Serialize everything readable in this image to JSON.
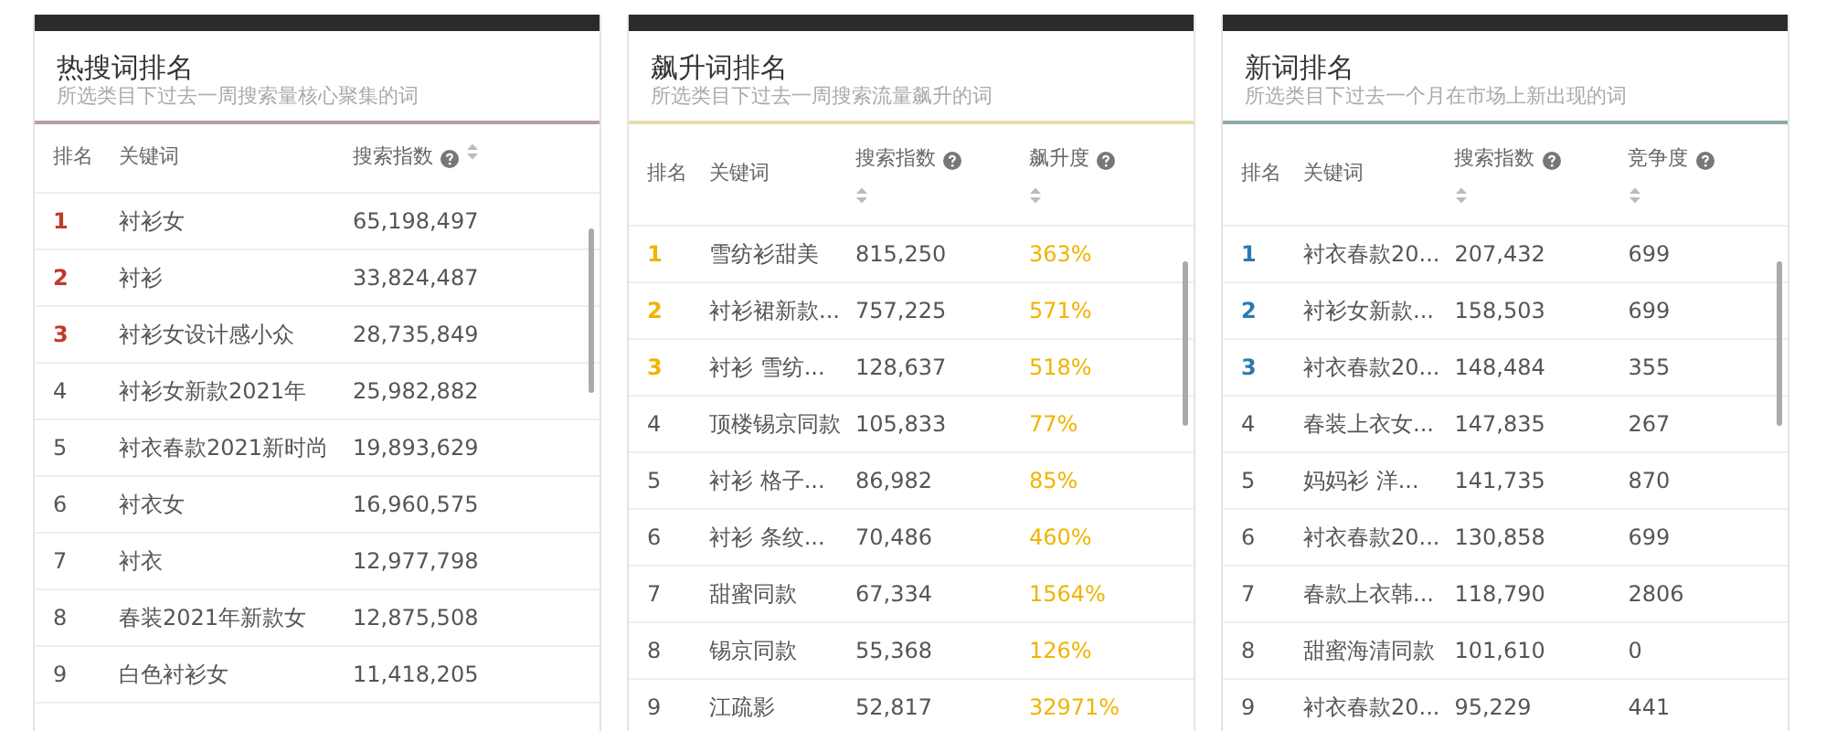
{
  "panels": [
    {
      "kind": "hot",
      "title": "热搜词排名",
      "subtitle": "所选类目下过去一周搜索量核心聚集的词",
      "columns": [
        {
          "label": "排名",
          "kind": "rank",
          "help": false,
          "sortable": false
        },
        {
          "label": "关键词",
          "kind": "text",
          "help": false,
          "sortable": false
        },
        {
          "label": "搜索指数",
          "kind": "number",
          "help": true,
          "sortable": true
        }
      ],
      "rows": [
        {
          "highlighted": true,
          "cells": [
            "1",
            "衬衫女",
            "65,198,497"
          ]
        },
        {
          "highlighted": true,
          "cells": [
            "2",
            "衬衫",
            "33,824,487"
          ]
        },
        {
          "highlighted": true,
          "cells": [
            "3",
            "衬衫女设计感小众",
            "28,735,849"
          ]
        },
        {
          "highlighted": false,
          "cells": [
            "4",
            "衬衫女新款2021年",
            "25,982,882"
          ]
        },
        {
          "highlighted": false,
          "cells": [
            "5",
            "衬衣春款2021新时尚",
            "19,893,629"
          ]
        },
        {
          "highlighted": false,
          "cells": [
            "6",
            "衬衣女",
            "16,960,575"
          ]
        },
        {
          "highlighted": false,
          "cells": [
            "7",
            "衬衣",
            "12,977,798"
          ]
        },
        {
          "highlighted": false,
          "cells": [
            "8",
            "春装2021年新款女",
            "12,875,508"
          ]
        },
        {
          "highlighted": false,
          "cells": [
            "9",
            "白色衬衫女",
            "11,418,205"
          ]
        }
      ]
    },
    {
      "kind": "rising",
      "title": "飙升词排名",
      "subtitle": "所选类目下过去一周搜索流量飙升的词",
      "columns": [
        {
          "label": "排名",
          "kind": "rank",
          "help": false,
          "sortable": false
        },
        {
          "label": "关键词",
          "kind": "text",
          "help": false,
          "sortable": false
        },
        {
          "label": "搜索指数",
          "kind": "number",
          "help": true,
          "sortable": true
        },
        {
          "label": "飙升度",
          "kind": "rise",
          "help": true,
          "sortable": true
        }
      ],
      "rows": [
        {
          "highlighted": true,
          "cells": [
            "1",
            "雪纺衫甜美",
            "815,250",
            "363%"
          ]
        },
        {
          "highlighted": true,
          "cells": [
            "2",
            "衬衫裙新款...",
            "757,225",
            "571%"
          ]
        },
        {
          "highlighted": true,
          "cells": [
            "3",
            "衬衫 雪纺...",
            "128,637",
            "518%"
          ]
        },
        {
          "highlighted": false,
          "cells": [
            "4",
            "顶楼锡京同款",
            "105,833",
            "77%"
          ]
        },
        {
          "highlighted": false,
          "cells": [
            "5",
            "衬衫 格子...",
            "86,982",
            "85%"
          ]
        },
        {
          "highlighted": false,
          "cells": [
            "6",
            "衬衫 条纹...",
            "70,486",
            "460%"
          ]
        },
        {
          "highlighted": false,
          "cells": [
            "7",
            "甜蜜同款",
            "67,334",
            "1564%"
          ]
        },
        {
          "highlighted": false,
          "cells": [
            "8",
            "锡京同款",
            "55,368",
            "126%"
          ]
        },
        {
          "highlighted": false,
          "cells": [
            "9",
            "江疏影",
            "52,817",
            "32971%"
          ]
        }
      ]
    },
    {
      "kind": "new",
      "title": "新词排名",
      "subtitle": "所选类目下过去一个月在市场上新出现的词",
      "columns": [
        {
          "label": "排名",
          "kind": "rank",
          "help": false,
          "sortable": false
        },
        {
          "label": "关键词",
          "kind": "text",
          "help": false,
          "sortable": false
        },
        {
          "label": "搜索指数",
          "kind": "number",
          "help": true,
          "sortable": true
        },
        {
          "label": "竞争度",
          "kind": "number",
          "help": true,
          "sortable": true
        }
      ],
      "rows": [
        {
          "highlighted": true,
          "cells": [
            "1",
            "衬衣春款20...",
            "207,432",
            "699"
          ]
        },
        {
          "highlighted": true,
          "cells": [
            "2",
            "衬衫女新款...",
            "158,503",
            "699"
          ]
        },
        {
          "highlighted": true,
          "cells": [
            "3",
            "衬衣春款20...",
            "148,484",
            "355"
          ]
        },
        {
          "highlighted": false,
          "cells": [
            "4",
            "春装上衣女...",
            "147,835",
            "267"
          ]
        },
        {
          "highlighted": false,
          "cells": [
            "5",
            "妈妈衫 洋...",
            "141,735",
            "870"
          ]
        },
        {
          "highlighted": false,
          "cells": [
            "6",
            "衬衣春款20...",
            "130,858",
            "699"
          ]
        },
        {
          "highlighted": false,
          "cells": [
            "7",
            "春款上衣韩...",
            "118,790",
            "2806"
          ]
        },
        {
          "highlighted": false,
          "cells": [
            "8",
            "甜蜜海清同款",
            "101,610",
            "0"
          ]
        },
        {
          "highlighted": false,
          "cells": [
            "9",
            "衬衣春款20...",
            "95,229",
            "441"
          ]
        }
      ]
    }
  ]
}
